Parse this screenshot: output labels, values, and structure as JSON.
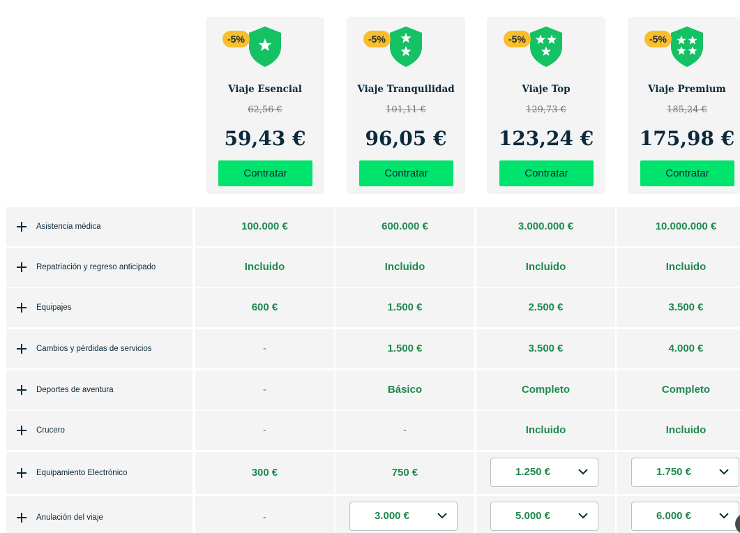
{
  "colors": {
    "accent_green": "#00e36c",
    "value_green": "#1f8a4c",
    "badge_yellow": "#f8be2b",
    "shield_green": "#14c163",
    "navy": "#0b2a3c",
    "cell_bg": "#f4f4f4"
  },
  "plans": [
    {
      "name": "Viaje Esencial",
      "discount": "-5%",
      "old_price": "62,56 €",
      "price": "59,43 €",
      "button": "Contratar",
      "stars": 1
    },
    {
      "name": "Viaje Tranquilidad",
      "discount": "-5%",
      "old_price": "101,11 €",
      "price": "96,05 €",
      "button": "Contratar",
      "stars": 2
    },
    {
      "name": "Viaje Top",
      "discount": "-5%",
      "old_price": "129,73 €",
      "price": "123,24 €",
      "button": "Contratar",
      "stars": 3
    },
    {
      "name": "Viaje Premium",
      "discount": "-5%",
      "old_price": "185,24 €",
      "price": "175,98 €",
      "button": "Contratar",
      "stars": 4
    }
  ],
  "coverages": [
    {
      "label": "Asistencia médica",
      "values": [
        "100.000 €",
        "600.000 €",
        "3.000.000 €",
        "10.000.000 €"
      ]
    },
    {
      "label": "Repatriación y regreso anticipado",
      "values": [
        "Incluido",
        "Incluido",
        "Incluido",
        "Incluido"
      ]
    },
    {
      "label": "Equipajes",
      "values": [
        "600 €",
        "1.500 €",
        "2.500 €",
        "3.500 €"
      ]
    },
    {
      "label": "Cambios y pérdidas de servicios",
      "values": [
        "-",
        "1.500 €",
        "3.500 €",
        "4.000 €"
      ]
    },
    {
      "label": "Deportes de aventura",
      "values": [
        "-",
        "Básico",
        "Completo",
        "Completo"
      ]
    },
    {
      "label": "Crucero",
      "values": [
        "-",
        "-",
        "Incluido",
        "Incluido"
      ]
    },
    {
      "label": "Equipamiento Electrónico",
      "values": [
        "300 €",
        "750 €",
        "1.250 €",
        "1.750 €"
      ]
    },
    {
      "label": "Anulación del viaje",
      "values": [
        "-",
        "3.000 €",
        "5.000 €",
        "6.000 €"
      ]
    }
  ],
  "icons": {
    "expand": "plus-icon",
    "dropdown": "chevron-down-icon",
    "plan": "shield-star-icon"
  }
}
